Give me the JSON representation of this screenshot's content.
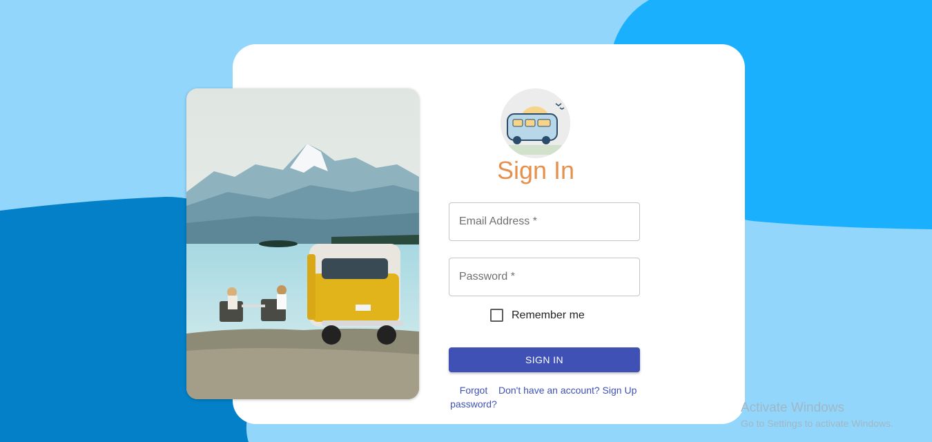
{
  "colors": {
    "background_light": "#93d6fb",
    "background_accent": "#1ab0fe",
    "background_dark": "#0380c7",
    "title": "#e6904e",
    "button": "#3f51b5",
    "link": "#3f51b5"
  },
  "hero_image": {
    "name": "mountain-lake-camper-photo"
  },
  "logo": {
    "name": "tripy-camper-van-logo"
  },
  "form": {
    "title": "Sign In",
    "email_placeholder": "Email Address *",
    "password_placeholder": "Password *",
    "remember_label": "Remember me",
    "submit_label": "SIGN IN",
    "forgot_link": "Forgot password?",
    "signup_link": "Don't have an account? Sign Up"
  },
  "os_watermark": {
    "line1": "Activate Windows",
    "line2": "Go to Settings to activate Windows."
  }
}
